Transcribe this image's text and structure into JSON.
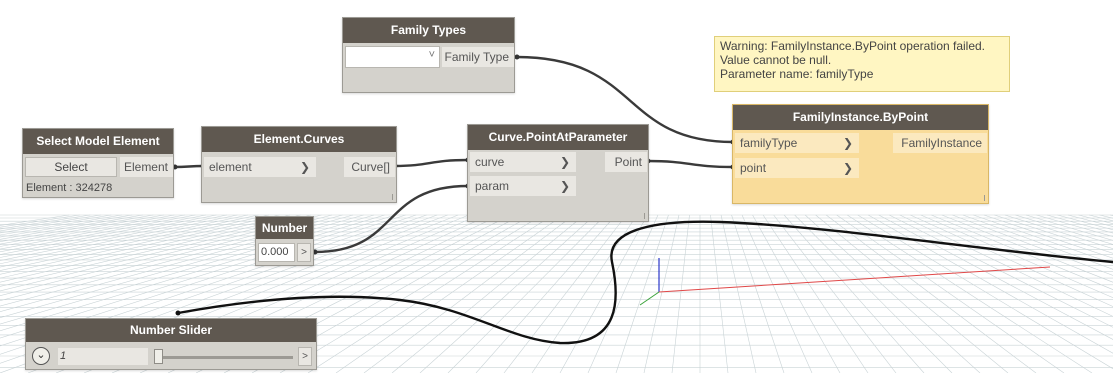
{
  "nodes": {
    "family_types": {
      "title": "Family Types",
      "dropdown_arrow": "˅",
      "output_label": "Family Type"
    },
    "select_model_element": {
      "title": "Select Model Element",
      "select_label": "Select",
      "output_label": "Element",
      "status": "Element : 324278"
    },
    "element_curves": {
      "title": "Element.Curves",
      "input_label": "element",
      "output_label": "Curve[]"
    },
    "curve_point_at_parameter": {
      "title": "Curve.PointAtParameter",
      "inputs": [
        "curve",
        "param"
      ],
      "output_label": "Point"
    },
    "family_instance_by_point": {
      "title": "FamilyInstance.ByPoint",
      "inputs": [
        "familyType",
        "point"
      ],
      "output_label": "FamilyInstance",
      "status": "warning"
    },
    "number": {
      "title": "Number",
      "value": "0.000",
      "output_glyph": ">"
    },
    "number_slider": {
      "title": "Number Slider",
      "value": "1",
      "slider_fraction": 0.0,
      "expand_glyph": "⌄",
      "output_glyph": ">"
    }
  },
  "warning_tooltip": {
    "lines": [
      "Warning: FamilyInstance.ByPoint operation failed.",
      "Value cannot be null.",
      "Parameter name: familyType"
    ]
  },
  "port_chevron": "❯",
  "colors": {
    "node_header": "#5f5850",
    "node_body": "#d4d2cc",
    "warning_body": "#f9dc9a",
    "tooltip_bg": "#fff6c2",
    "wire": "#3a3a3a",
    "grid": "#c9d3d6"
  }
}
